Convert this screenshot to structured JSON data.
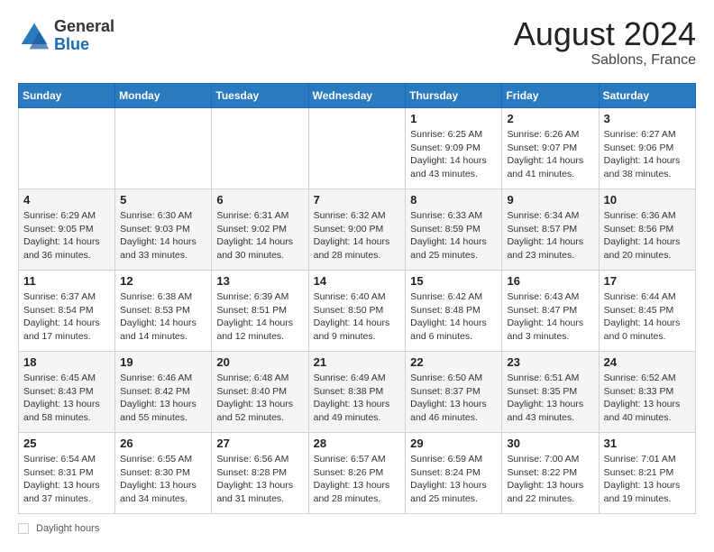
{
  "header": {
    "logo_general": "General",
    "logo_blue": "Blue",
    "month_year": "August 2024",
    "location": "Sablons, France"
  },
  "days_of_week": [
    "Sunday",
    "Monday",
    "Tuesday",
    "Wednesday",
    "Thursday",
    "Friday",
    "Saturday"
  ],
  "weeks": [
    [
      {
        "day": "",
        "sunrise": "",
        "sunset": "",
        "daylight": ""
      },
      {
        "day": "",
        "sunrise": "",
        "sunset": "",
        "daylight": ""
      },
      {
        "day": "",
        "sunrise": "",
        "sunset": "",
        "daylight": ""
      },
      {
        "day": "",
        "sunrise": "",
        "sunset": "",
        "daylight": ""
      },
      {
        "day": "1",
        "sunrise": "Sunrise: 6:25 AM",
        "sunset": "Sunset: 9:09 PM",
        "daylight": "Daylight: 14 hours and 43 minutes."
      },
      {
        "day": "2",
        "sunrise": "Sunrise: 6:26 AM",
        "sunset": "Sunset: 9:07 PM",
        "daylight": "Daylight: 14 hours and 41 minutes."
      },
      {
        "day": "3",
        "sunrise": "Sunrise: 6:27 AM",
        "sunset": "Sunset: 9:06 PM",
        "daylight": "Daylight: 14 hours and 38 minutes."
      }
    ],
    [
      {
        "day": "4",
        "sunrise": "Sunrise: 6:29 AM",
        "sunset": "Sunset: 9:05 PM",
        "daylight": "Daylight: 14 hours and 36 minutes."
      },
      {
        "day": "5",
        "sunrise": "Sunrise: 6:30 AM",
        "sunset": "Sunset: 9:03 PM",
        "daylight": "Daylight: 14 hours and 33 minutes."
      },
      {
        "day": "6",
        "sunrise": "Sunrise: 6:31 AM",
        "sunset": "Sunset: 9:02 PM",
        "daylight": "Daylight: 14 hours and 30 minutes."
      },
      {
        "day": "7",
        "sunrise": "Sunrise: 6:32 AM",
        "sunset": "Sunset: 9:00 PM",
        "daylight": "Daylight: 14 hours and 28 minutes."
      },
      {
        "day": "8",
        "sunrise": "Sunrise: 6:33 AM",
        "sunset": "Sunset: 8:59 PM",
        "daylight": "Daylight: 14 hours and 25 minutes."
      },
      {
        "day": "9",
        "sunrise": "Sunrise: 6:34 AM",
        "sunset": "Sunset: 8:57 PM",
        "daylight": "Daylight: 14 hours and 23 minutes."
      },
      {
        "day": "10",
        "sunrise": "Sunrise: 6:36 AM",
        "sunset": "Sunset: 8:56 PM",
        "daylight": "Daylight: 14 hours and 20 minutes."
      }
    ],
    [
      {
        "day": "11",
        "sunrise": "Sunrise: 6:37 AM",
        "sunset": "Sunset: 8:54 PM",
        "daylight": "Daylight: 14 hours and 17 minutes."
      },
      {
        "day": "12",
        "sunrise": "Sunrise: 6:38 AM",
        "sunset": "Sunset: 8:53 PM",
        "daylight": "Daylight: 14 hours and 14 minutes."
      },
      {
        "day": "13",
        "sunrise": "Sunrise: 6:39 AM",
        "sunset": "Sunset: 8:51 PM",
        "daylight": "Daylight: 14 hours and 12 minutes."
      },
      {
        "day": "14",
        "sunrise": "Sunrise: 6:40 AM",
        "sunset": "Sunset: 8:50 PM",
        "daylight": "Daylight: 14 hours and 9 minutes."
      },
      {
        "day": "15",
        "sunrise": "Sunrise: 6:42 AM",
        "sunset": "Sunset: 8:48 PM",
        "daylight": "Daylight: 14 hours and 6 minutes."
      },
      {
        "day": "16",
        "sunrise": "Sunrise: 6:43 AM",
        "sunset": "Sunset: 8:47 PM",
        "daylight": "Daylight: 14 hours and 3 minutes."
      },
      {
        "day": "17",
        "sunrise": "Sunrise: 6:44 AM",
        "sunset": "Sunset: 8:45 PM",
        "daylight": "Daylight: 14 hours and 0 minutes."
      }
    ],
    [
      {
        "day": "18",
        "sunrise": "Sunrise: 6:45 AM",
        "sunset": "Sunset: 8:43 PM",
        "daylight": "Daylight: 13 hours and 58 minutes."
      },
      {
        "day": "19",
        "sunrise": "Sunrise: 6:46 AM",
        "sunset": "Sunset: 8:42 PM",
        "daylight": "Daylight: 13 hours and 55 minutes."
      },
      {
        "day": "20",
        "sunrise": "Sunrise: 6:48 AM",
        "sunset": "Sunset: 8:40 PM",
        "daylight": "Daylight: 13 hours and 52 minutes."
      },
      {
        "day": "21",
        "sunrise": "Sunrise: 6:49 AM",
        "sunset": "Sunset: 8:38 PM",
        "daylight": "Daylight: 13 hours and 49 minutes."
      },
      {
        "day": "22",
        "sunrise": "Sunrise: 6:50 AM",
        "sunset": "Sunset: 8:37 PM",
        "daylight": "Daylight: 13 hours and 46 minutes."
      },
      {
        "day": "23",
        "sunrise": "Sunrise: 6:51 AM",
        "sunset": "Sunset: 8:35 PM",
        "daylight": "Daylight: 13 hours and 43 minutes."
      },
      {
        "day": "24",
        "sunrise": "Sunrise: 6:52 AM",
        "sunset": "Sunset: 8:33 PM",
        "daylight": "Daylight: 13 hours and 40 minutes."
      }
    ],
    [
      {
        "day": "25",
        "sunrise": "Sunrise: 6:54 AM",
        "sunset": "Sunset: 8:31 PM",
        "daylight": "Daylight: 13 hours and 37 minutes."
      },
      {
        "day": "26",
        "sunrise": "Sunrise: 6:55 AM",
        "sunset": "Sunset: 8:30 PM",
        "daylight": "Daylight: 13 hours and 34 minutes."
      },
      {
        "day": "27",
        "sunrise": "Sunrise: 6:56 AM",
        "sunset": "Sunset: 8:28 PM",
        "daylight": "Daylight: 13 hours and 31 minutes."
      },
      {
        "day": "28",
        "sunrise": "Sunrise: 6:57 AM",
        "sunset": "Sunset: 8:26 PM",
        "daylight": "Daylight: 13 hours and 28 minutes."
      },
      {
        "day": "29",
        "sunrise": "Sunrise: 6:59 AM",
        "sunset": "Sunset: 8:24 PM",
        "daylight": "Daylight: 13 hours and 25 minutes."
      },
      {
        "day": "30",
        "sunrise": "Sunrise: 7:00 AM",
        "sunset": "Sunset: 8:22 PM",
        "daylight": "Daylight: 13 hours and 22 minutes."
      },
      {
        "day": "31",
        "sunrise": "Sunrise: 7:01 AM",
        "sunset": "Sunset: 8:21 PM",
        "daylight": "Daylight: 13 hours and 19 minutes."
      }
    ]
  ],
  "footer": {
    "label": "Daylight hours"
  }
}
